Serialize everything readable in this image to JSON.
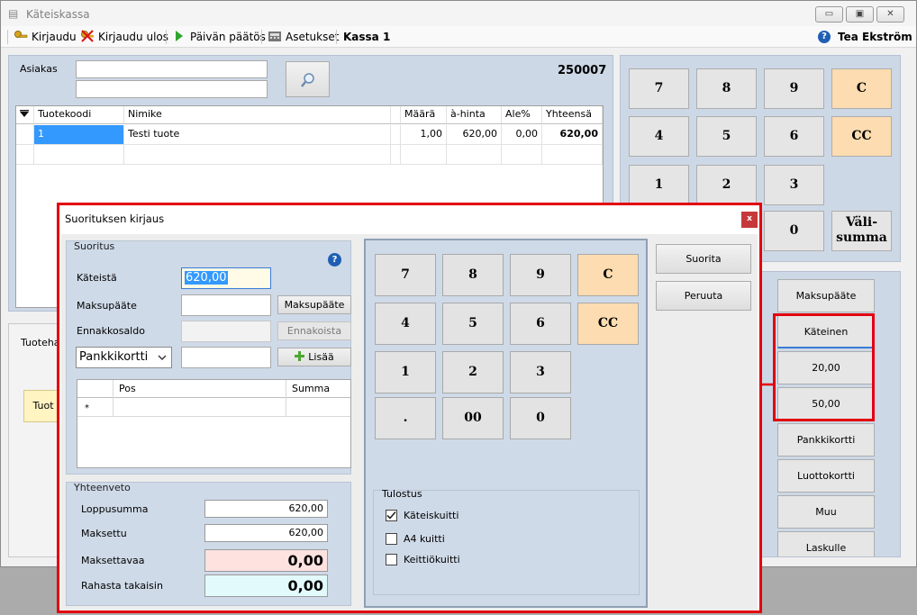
{
  "window": {
    "title": "Käteiskassa",
    "min_glyph": "▭",
    "max_glyph": "▣",
    "close_glyph": "✕"
  },
  "toolbar": {
    "login": "Kirjaudu",
    "logout": "Kirjaudu ulos",
    "day_close": "Päivän päätös",
    "settings": "Asetukset",
    "register": "Kassa 1",
    "help_glyph": "?",
    "user": "Tea Ekström"
  },
  "customer": {
    "label": "Asiakas",
    "field1": "",
    "field2": "",
    "receipt_number": "250007",
    "search_glyph": "🔍"
  },
  "grid": {
    "columns": [
      "Tuotekoodi",
      "Nimike",
      "",
      "Määrä",
      "à-hinta",
      "Ale%",
      "Yhteensä"
    ],
    "rows": [
      [
        "1",
        "Testi tuote",
        "",
        "1,00",
        "620,00",
        "0,00",
        "620,00"
      ]
    ]
  },
  "bottom_left": {
    "label_partial": "Tuotehal",
    "button_partial": "Tuot"
  },
  "numpad": {
    "keys": [
      "7",
      "8",
      "9",
      "C",
      "4",
      "5",
      "6",
      "CC",
      "1",
      "2",
      "3",
      "0",
      "Väli-\nsumma"
    ]
  },
  "pay_buttons": [
    "Maksupääte",
    "Käteinen",
    "20,00",
    "50,00",
    "Pankkikortti",
    "Luottokortti",
    "Muu",
    "Laskulle"
  ],
  "dialog": {
    "title": "Suorituksen kirjaus",
    "close_glyph": "x",
    "suoritus": {
      "title": "Suoritus",
      "help_glyph": "?",
      "cash_label": "Käteistä",
      "cash_value": "620,00",
      "terminal_label": "Maksupääte",
      "terminal_value": "",
      "terminal_button": "Maksupääte",
      "prepaid_label": "Ennakkosaldo",
      "prepaid_value": "",
      "prepaid_button": "Ennakoista",
      "method_select": "Pankkikortti",
      "method_amount": "",
      "add_button": "Lisää",
      "pos_columns": [
        "Pos",
        "Summa"
      ],
      "new_row_marker": "*"
    },
    "summary": {
      "title": "Yhteenveto",
      "total_label": "Loppusumma",
      "total_value": "620,00",
      "paid_label": "Maksettu",
      "paid_value": "620,00",
      "due_label": "Maksettavaa",
      "due_value": "0,00",
      "change_label": "Rahasta takaisin",
      "change_value": "0,00"
    },
    "numpad": {
      "keys": [
        "7",
        "8",
        "9",
        "C",
        "4",
        "5",
        "6",
        "CC",
        "1",
        "2",
        "3",
        ".",
        "00",
        "0"
      ]
    },
    "print": {
      "title": "Tulostus",
      "options": [
        {
          "label": "Käteiskuitti",
          "checked": true
        },
        {
          "label": "A4 kuitti",
          "checked": false
        },
        {
          "label": "Keittiökuitti",
          "checked": false
        }
      ]
    },
    "confirm_button": "Suorita",
    "cancel_button": "Peruuta"
  },
  "colors": {
    "highlight": "#e3000f",
    "panel": "#cdd8e6",
    "orange_key": "#fcdcb0",
    "due_bg": "#fde2df",
    "change_bg": "#e2fafb"
  }
}
